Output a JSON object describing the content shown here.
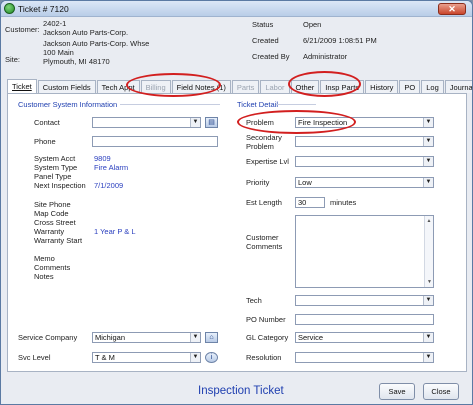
{
  "window": {
    "title": "Ticket # 7120",
    "close": "✕"
  },
  "header": {
    "customer_label": "Customer:",
    "customer_id": "2402-1",
    "customer_name": "Jackson Auto Parts-Corp.",
    "site_label": "Site:",
    "site_name": "Jackson Auto Parts-Corp. Whse",
    "site_addr1": "100 Main",
    "site_addr2": "Plymouth, MI  48170",
    "status_label": "Status",
    "status_value": "Open",
    "created_label": "Created",
    "created_value": "6/21/2009 1:08:51 PM",
    "createdby_label": "Created By",
    "createdby_value": "Administrator"
  },
  "tabs": [
    {
      "label": "Ticket"
    },
    {
      "label": "Custom Fields"
    },
    {
      "label": "Tech Appt"
    },
    {
      "label": "Billing"
    },
    {
      "label": "Field Notes (1)"
    },
    {
      "label": "Parts"
    },
    {
      "label": "Labor"
    },
    {
      "label": "Other"
    },
    {
      "label": "Insp Parts"
    },
    {
      "label": "History"
    },
    {
      "label": "PO"
    },
    {
      "label": "Log"
    },
    {
      "label": "Journal"
    }
  ],
  "left": {
    "section": "Customer System Information",
    "contact_label": "Contact",
    "contact_value": "",
    "phone_label": "Phone",
    "phone_value": "",
    "system_acct_label": "System Acct",
    "system_acct_value": "9809",
    "system_type_label": "System Type",
    "system_type_value": "Fire Alarm",
    "panel_type_label": "Panel Type",
    "next_insp_label": "Next Inspection",
    "next_insp_value": "7/1/2009",
    "site_phone_label": "Site Phone",
    "map_code_label": "Map Code",
    "cross_street_label": "Cross Street",
    "warranty_label": "Warranty",
    "warranty_value": "1 Year P & L",
    "warranty_start_label": "Warranty Start",
    "memo_label": "Memo",
    "comments_label": "Comments",
    "notes_label": "Notes",
    "service_company_label": "Service Company",
    "service_company_value": "Michigan",
    "svc_level_label": "Svc Level",
    "svc_level_value": "T & M"
  },
  "right": {
    "section": "Ticket Detail",
    "problem_label": "Problem",
    "problem_value": "Fire Inspection",
    "secondary_label": "Secondary Problem",
    "secondary_value": "",
    "expertise_label": "Expertise Lvl",
    "expertise_value": "",
    "priority_label": "Priority",
    "priority_value": "Low",
    "est_length_label": "Est Length",
    "est_length_value": "30",
    "minutes_label": "minutes",
    "customer_comments_label": "Customer Comments",
    "tech_label": "Tech",
    "tech_value": "",
    "po_label": "PO Number",
    "po_value": "",
    "gl_label": "GL Category",
    "gl_value": "Service",
    "resolution_label": "Resolution",
    "resolution_value": ""
  },
  "footer": {
    "title": "Inspection Ticket",
    "save": "Save",
    "close": "Close"
  },
  "colors": {
    "annotation": "#d21f1f",
    "accent_blue": "#1f3fb0"
  }
}
